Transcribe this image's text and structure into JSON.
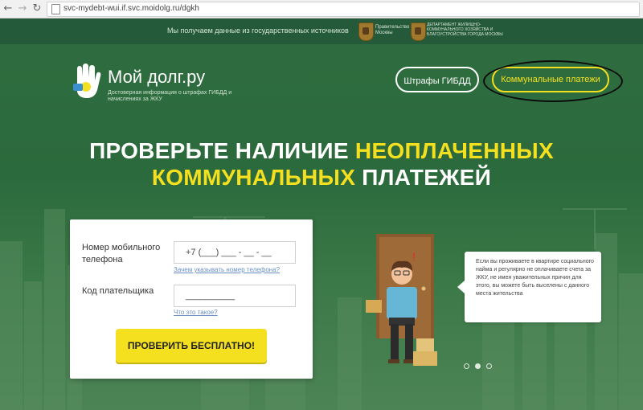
{
  "browser": {
    "back_icon": "arrow-left-icon",
    "forward_icon": "arrow-right-icon",
    "reload_icon": "reload-icon",
    "url": "svc-mydebt-wui.if.svc.moidolg.ru/dgkh"
  },
  "header": {
    "sources_text": "Мы получаем данные из государственных источников",
    "gov1": "Правительство Москвы",
    "gov2": "ДЕПАРТАМЕНТ ЖИЛИЩНО-КОММУНАЛЬНОГО ХОЗЯЙСТВА И БЛАГОУСТРОЙСТВА ГОРОДА МОСКВЫ",
    "brand": "Мой долг.ру",
    "tagline": "Достоверная информация о штрафах ГИБДД и начислениях за ЖКУ",
    "nav_gibdd": "Штрафы ГИБДД",
    "nav_komm": "Коммунальные платежи"
  },
  "hero": {
    "line1_white": "ПРОВЕРЬТЕ НАЛИЧИЕ ",
    "line1_yellow": "НЕОПЛАЧЕННЫХ",
    "line2_yellow": "КОММУНАЛЬНЫХ",
    "line2_white": " ПЛАТЕЖЕЙ"
  },
  "form": {
    "phone_label": "Номер мобильного телефона",
    "phone_placeholder": "+7 (___) ___ - __ - __",
    "phone_help": "Зачем указывать номер телефона?",
    "code_label": "Код плательщика",
    "code_placeholder": "__________",
    "code_help": "Что это такое?",
    "submit": "ПРОВЕРИТЬ БЕСПЛАТНО!"
  },
  "bubble_text": "Если вы проживаете в квартире социального найма и регулярно не оплачиваете счета за ЖКУ, не имея уважительных причин для этого, вы можете быть выселены с данного места жительства",
  "carousel": {
    "slides": 3,
    "active": 2
  },
  "colors": {
    "accent": "#f5e020",
    "background": "#2e6a3f",
    "annotation": "#0c0c0c"
  }
}
